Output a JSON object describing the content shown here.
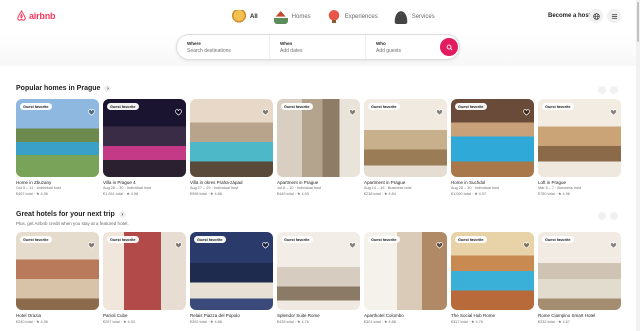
{
  "brand": {
    "logo_text": "airbnb",
    "accent": "#ff385c"
  },
  "categories": [
    {
      "label": "All",
      "icon": "globe-house-icon",
      "active": true
    },
    {
      "label": "Homes",
      "icon": "house-icon",
      "active": false
    },
    {
      "label": "Experiences",
      "icon": "balloon-icon",
      "active": false
    },
    {
      "label": "Services",
      "icon": "service-bell-icon",
      "active": false
    }
  ],
  "header": {
    "host_label": "Become a host"
  },
  "search": {
    "where": {
      "label": "Where",
      "placeholder": "Search destinations"
    },
    "when": {
      "label": "When",
      "placeholder": "Add dates"
    },
    "who": {
      "label": "Who",
      "placeholder": "Add guests"
    }
  },
  "sections": [
    {
      "title": "Popular homes in Prague",
      "cards": [
        {
          "badge": "Guest favorite",
          "title": "Home in Zbuzany",
          "sub": "Oct 5 – 11 · Individual host",
          "price": "€497 total · ★ 4.96"
        },
        {
          "badge": "Guest favorite",
          "title": "Villa in Prague 4",
          "sub": "Aug 28 – 30 · Individual host",
          "price": "€1,261 total · ★ 4.98"
        },
        {
          "badge": "",
          "title": "Villa in okres Praha-západ",
          "sub": "Aug 27 – 29 · Individual host",
          "price": "€998 total · ★ 4.88"
        },
        {
          "badge": "Guest favorite",
          "title": "Apartment in Prague",
          "sub": "Jul 8 – 10 · Individual host",
          "price": "€449 total · ★ 4.93"
        },
        {
          "badge": "Guest favorite",
          "title": "Apartment in Prague",
          "sub": "Aug 14 – 16 · Business host",
          "price": "€238 total · ★ 4.84"
        },
        {
          "badge": "Guest favorite",
          "title": "Home in Suchdol",
          "sub": "Aug 28 – 30 · Individual host",
          "price": "€1,090 total · ★ 4.97"
        },
        {
          "badge": "Guest favorite",
          "title": "Loft in Prague",
          "sub": "Mar 5 – 7 · Business host",
          "price": "€780 total · ★ 4.96"
        }
      ]
    },
    {
      "title": "Great hotels for your next trip",
      "subtitle": "Plus, get Airbnb credit when you stay at a featured hotel.",
      "cards": [
        {
          "badge": "Guest favorite",
          "title": "Hotel Orazia",
          "sub": "",
          "price": "€240 total · ★ 4.96"
        },
        {
          "badge": "Guest favorite",
          "title": "Parioli Cube",
          "sub": "",
          "price": "€297 total · ★ 4.93"
        },
        {
          "badge": "Guest favorite",
          "title": "Relais Piazza del Popolo",
          "sub": "",
          "price": "€302 total · ★ 4.88"
        },
        {
          "badge": "Guest favorite",
          "title": "Splendor Suite Rome",
          "sub": "",
          "price": "€435 total · ★ 4.76"
        },
        {
          "badge": "Guest favorite",
          "title": "Aparthotel Colombo",
          "sub": "",
          "price": "€301 total · ★ 4.88"
        },
        {
          "badge": "Guest favorite",
          "title": "The Social Hub Rome",
          "sub": "",
          "price": "€317 total · ★ 4.76"
        },
        {
          "badge": "Guest favorite",
          "title": "Rome Ciampino Smart Hotel",
          "sub": "",
          "price": "€232 total · ★ 4.67"
        }
      ]
    }
  ]
}
